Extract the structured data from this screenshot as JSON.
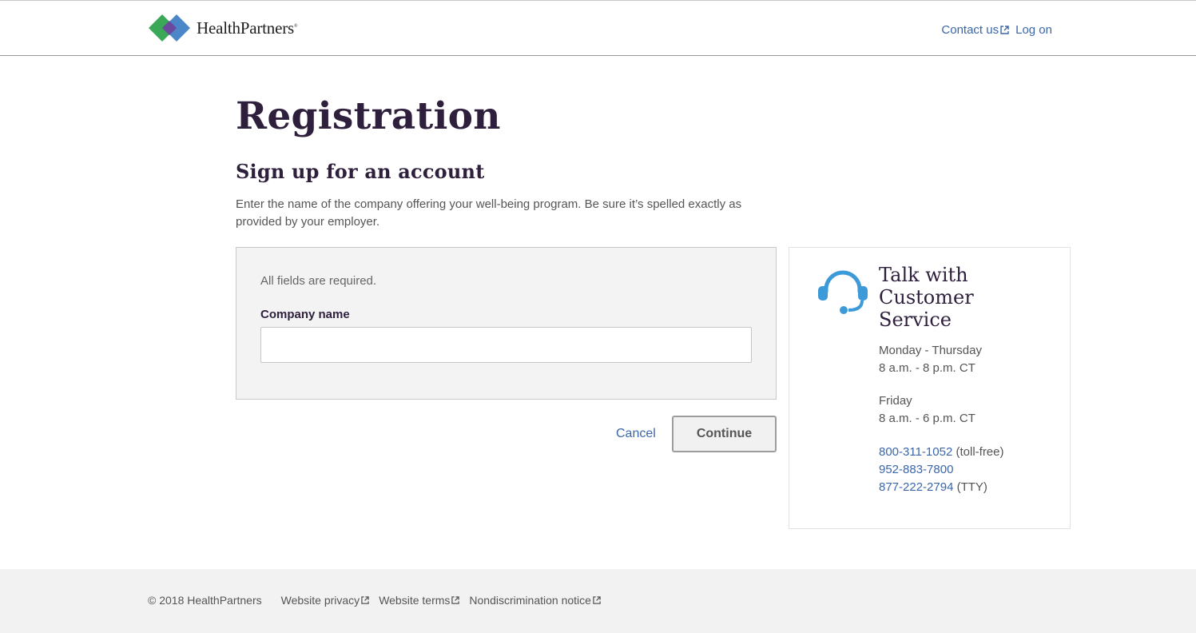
{
  "header": {
    "logo_text": "HealthPartners",
    "logo_mark": "®",
    "nav": {
      "contact_label": "Contact us",
      "logon_label": "Log on"
    }
  },
  "main": {
    "title": "Registration",
    "subtitle": "Sign up for an account",
    "intro": "Enter the name of the company offering your well-being program. Be sure it’s spelled exactly as provided by your employer.",
    "form": {
      "required_note": "All fields are required.",
      "company_label": "Company name",
      "company_value": "",
      "company_placeholder": ""
    },
    "actions": {
      "cancel_label": "Cancel",
      "continue_label": "Continue"
    }
  },
  "customer_service": {
    "icon": "headset-icon",
    "title": "Talk with Customer Service",
    "hours": [
      {
        "days": "Monday - Thursday",
        "time": "8 a.m. - 8 p.m. CT"
      },
      {
        "days": "Friday",
        "time": "8 a.m. - 6 p.m. CT"
      }
    ],
    "phones": [
      {
        "number": "800-311-1052",
        "note": "(toll-free)"
      },
      {
        "number": "952-883-7800",
        "note": ""
      },
      {
        "number": "877-222-2794",
        "note": "(TTY)"
      }
    ]
  },
  "footer": {
    "copyright": "© 2018 HealthPartners",
    "links": [
      "Website privacy",
      "Website terms",
      "Nondiscrimination notice"
    ]
  },
  "colors": {
    "link": "#3b66a8",
    "heading": "#2e1f3d",
    "icon_blue": "#3d9ad9",
    "logo_green": "#3aa856",
    "logo_blue": "#4a86c8",
    "logo_purple": "#6b4a9e"
  }
}
